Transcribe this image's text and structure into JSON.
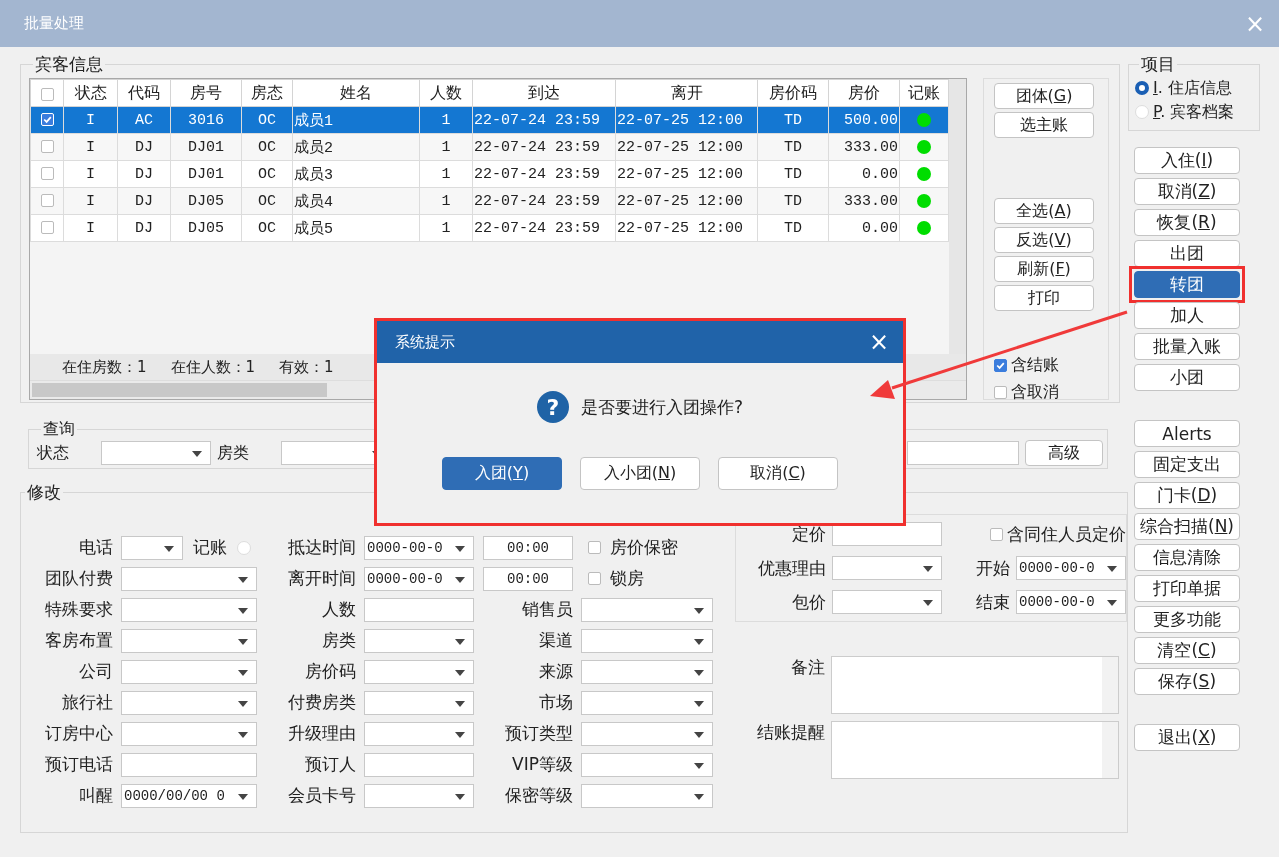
{
  "window": {
    "title": "批量处理",
    "close": "×"
  },
  "guest_info": {
    "title": "宾客信息",
    "header_checked": false,
    "columns": [
      {
        "label": "状态"
      },
      {
        "label": "代码"
      },
      {
        "label": "房号"
      },
      {
        "label": "房态"
      },
      {
        "label": "姓名"
      },
      {
        "label": "人数"
      },
      {
        "label": "到达"
      },
      {
        "label": "离开"
      },
      {
        "label": "房价码"
      },
      {
        "label": "房价"
      },
      {
        "label": "记账"
      }
    ],
    "rows": [
      {
        "checked": true,
        "selected": true,
        "cells": [
          "I",
          "AC",
          "3016",
          "OC",
          "成员1",
          "1",
          "22-07-24 23:59",
          "22-07-25 12:00",
          "TD",
          "500.00"
        ],
        "color": "#00dd00"
      },
      {
        "checked": false,
        "selected": false,
        "cells": [
          "I",
          "DJ",
          "DJ01",
          "OC",
          "成员2",
          "1",
          "22-07-24 23:59",
          "22-07-25 12:00",
          "TD",
          "333.00"
        ],
        "color": "#00dd00"
      },
      {
        "checked": false,
        "selected": false,
        "cells": [
          "I",
          "DJ",
          "DJ01",
          "OC",
          "成员3",
          "1",
          "22-07-24 23:59",
          "22-07-25 12:00",
          "TD",
          "0.00"
        ],
        "color": "#00dd00"
      },
      {
        "checked": false,
        "selected": false,
        "cells": [
          "I",
          "DJ",
          "DJ05",
          "OC",
          "成员4",
          "1",
          "22-07-24 23:59",
          "22-07-25 12:00",
          "TD",
          "333.00"
        ],
        "color": "#00dd00"
      },
      {
        "checked": false,
        "selected": false,
        "cells": [
          "I",
          "DJ",
          "DJ05",
          "OC",
          "成员5",
          "1",
          "22-07-24 23:59",
          "22-07-25 12:00",
          "TD",
          "0.00"
        ],
        "color": "#00dd00"
      }
    ],
    "summary": [
      "在住房数：1",
      "在住人数：1",
      "有效：1"
    ],
    "side_buttons_top": [
      {
        "label": "团体(",
        "accel": "G",
        "tail": ")"
      },
      {
        "label": "选主账"
      }
    ],
    "side_buttons": [
      {
        "label": "全选(",
        "accel": "A",
        "tail": ")"
      },
      {
        "label": "反选(",
        "accel": "V",
        "tail": ")"
      },
      {
        "label": "刷新(",
        "accel": "F",
        "tail": ")"
      },
      {
        "label": "打印"
      }
    ],
    "checks": [
      {
        "label": "含结账",
        "checked": true
      },
      {
        "label": "含取消",
        "checked": false
      }
    ]
  },
  "query": {
    "title": "查询",
    "fields": [
      {
        "label": "状态"
      },
      {
        "label": "房类"
      }
    ],
    "button": "高级"
  },
  "modify": {
    "title": "修改",
    "rows": [
      [
        {
          "kind": "phone",
          "label": "电话",
          "radio": {
            "label": "记账",
            "selected": false
          }
        },
        {
          "kind": "datetime",
          "label": "抵达时间",
          "value": "0000-00-0",
          "time": "00:00",
          "check": {
            "label": "房价保密",
            "checked": false
          }
        }
      ],
      [
        {
          "kind": "dropdown",
          "label": "团队付费"
        },
        {
          "kind": "datetime",
          "label": "离开时间",
          "value": "0000-00-0",
          "time": "00:00",
          "check": {
            "label": "锁房",
            "checked": false
          }
        }
      ],
      [
        {
          "kind": "dropdown",
          "label": "特殊要求"
        },
        {
          "kind": "text",
          "label": "人数"
        },
        {
          "kind": "dropdown",
          "label": "销售员"
        }
      ],
      [
        {
          "kind": "dropdown",
          "label": "客房布置"
        },
        {
          "kind": "dropdown",
          "label": "房类"
        },
        {
          "kind": "dropdown",
          "label": "渠道"
        }
      ],
      [
        {
          "kind": "dropdown",
          "label": "公司"
        },
        {
          "kind": "dropdown",
          "label": "房价码"
        },
        {
          "kind": "dropdown",
          "label": "来源"
        }
      ],
      [
        {
          "kind": "dropdown",
          "label": "旅行社"
        },
        {
          "kind": "dropdown",
          "label": "付费房类"
        },
        {
          "kind": "dropdown",
          "label": "市场"
        }
      ],
      [
        {
          "kind": "dropdown",
          "label": "订房中心"
        },
        {
          "kind": "dropdown",
          "label": "升级理由"
        },
        {
          "kind": "dropdown",
          "label": "预订类型"
        }
      ],
      [
        {
          "kind": "text",
          "label": "预订电话"
        },
        {
          "kind": "text",
          "label": "预订人"
        },
        {
          "kind": "dropdown",
          "label": "VIP等级"
        }
      ],
      [
        {
          "kind": "dropdown",
          "label": "叫醒",
          "value": "0000/00/00 0"
        },
        {
          "kind": "dropdown",
          "label": "会员卡号"
        },
        {
          "kind": "dropdown",
          "label": "保密等级"
        }
      ]
    ],
    "pricing": [
      [
        {
          "kind": "text",
          "label": "定价"
        },
        {
          "kind": "check",
          "label": "含同住人员定价",
          "checked": false
        }
      ],
      [
        {
          "kind": "dropdown",
          "label": "优惠理由"
        },
        {
          "kind": "dropdown",
          "label": "开始",
          "value": "0000-00-0"
        }
      ],
      [
        {
          "kind": "dropdown",
          "label": "包价"
        },
        {
          "kind": "dropdown",
          "label": "结束",
          "value": "0000-00-0"
        }
      ]
    ],
    "notes": [
      {
        "label": "备注"
      },
      {
        "label": "结账提醒"
      }
    ]
  },
  "project": {
    "title": "项目",
    "options": [
      {
        "selected": true,
        "accel": "I",
        "tail": ". 住店信息"
      },
      {
        "selected": false,
        "accel": "P",
        "tail": ". 宾客档案"
      }
    ]
  },
  "action_groups": [
    [
      {
        "highlighted": false,
        "label": "入住(",
        "accel": "I",
        "tail": ")"
      },
      {
        "highlighted": false,
        "label": "取消(",
        "accel": "Z",
        "tail": ")"
      },
      {
        "highlighted": false,
        "label": "恢复(",
        "accel": "R",
        "tail": ")"
      },
      {
        "highlighted": false,
        "label": "出团"
      },
      {
        "highlighted": true,
        "label": "转团"
      },
      {
        "highlighted": false,
        "label": "加人"
      },
      {
        "highlighted": false,
        "label": "批量入账"
      },
      {
        "highlighted": false,
        "label": "小团"
      }
    ],
    [
      {
        "highlighted": false,
        "label": "Alerts"
      },
      {
        "highlighted": false,
        "label": "固定支出"
      },
      {
        "highlighted": false,
        "label": "门卡(",
        "accel": "D",
        "tail": ")"
      },
      {
        "highlighted": false,
        "label": "综合扫描(",
        "accel": "N",
        "tail": ")"
      },
      {
        "highlighted": false,
        "label": "信息清除"
      },
      {
        "highlighted": false,
        "label": "打印单据"
      },
      {
        "highlighted": false,
        "label": "更多功能"
      },
      {
        "highlighted": false,
        "label": "清空(",
        "accel": "C",
        "tail": ")"
      },
      {
        "highlighted": false,
        "label": "保存(",
        "accel": "S",
        "tail": ")"
      }
    ],
    [
      {
        "highlighted": false,
        "label": "退出(",
        "accel": "X",
        "tail": ")"
      }
    ]
  ],
  "dialog": {
    "title": "系统提示",
    "close": "×",
    "icon": "?",
    "message": "是否要进行入团操作?",
    "buttons": [
      {
        "default": true,
        "label": "入团(",
        "accel": "Y",
        "tail": ")"
      },
      {
        "default": false,
        "label": "入小团(",
        "accel": "N",
        "tail": ")"
      },
      {
        "default": false,
        "label": "取消(",
        "accel": "C",
        "tail": ")"
      }
    ]
  }
}
